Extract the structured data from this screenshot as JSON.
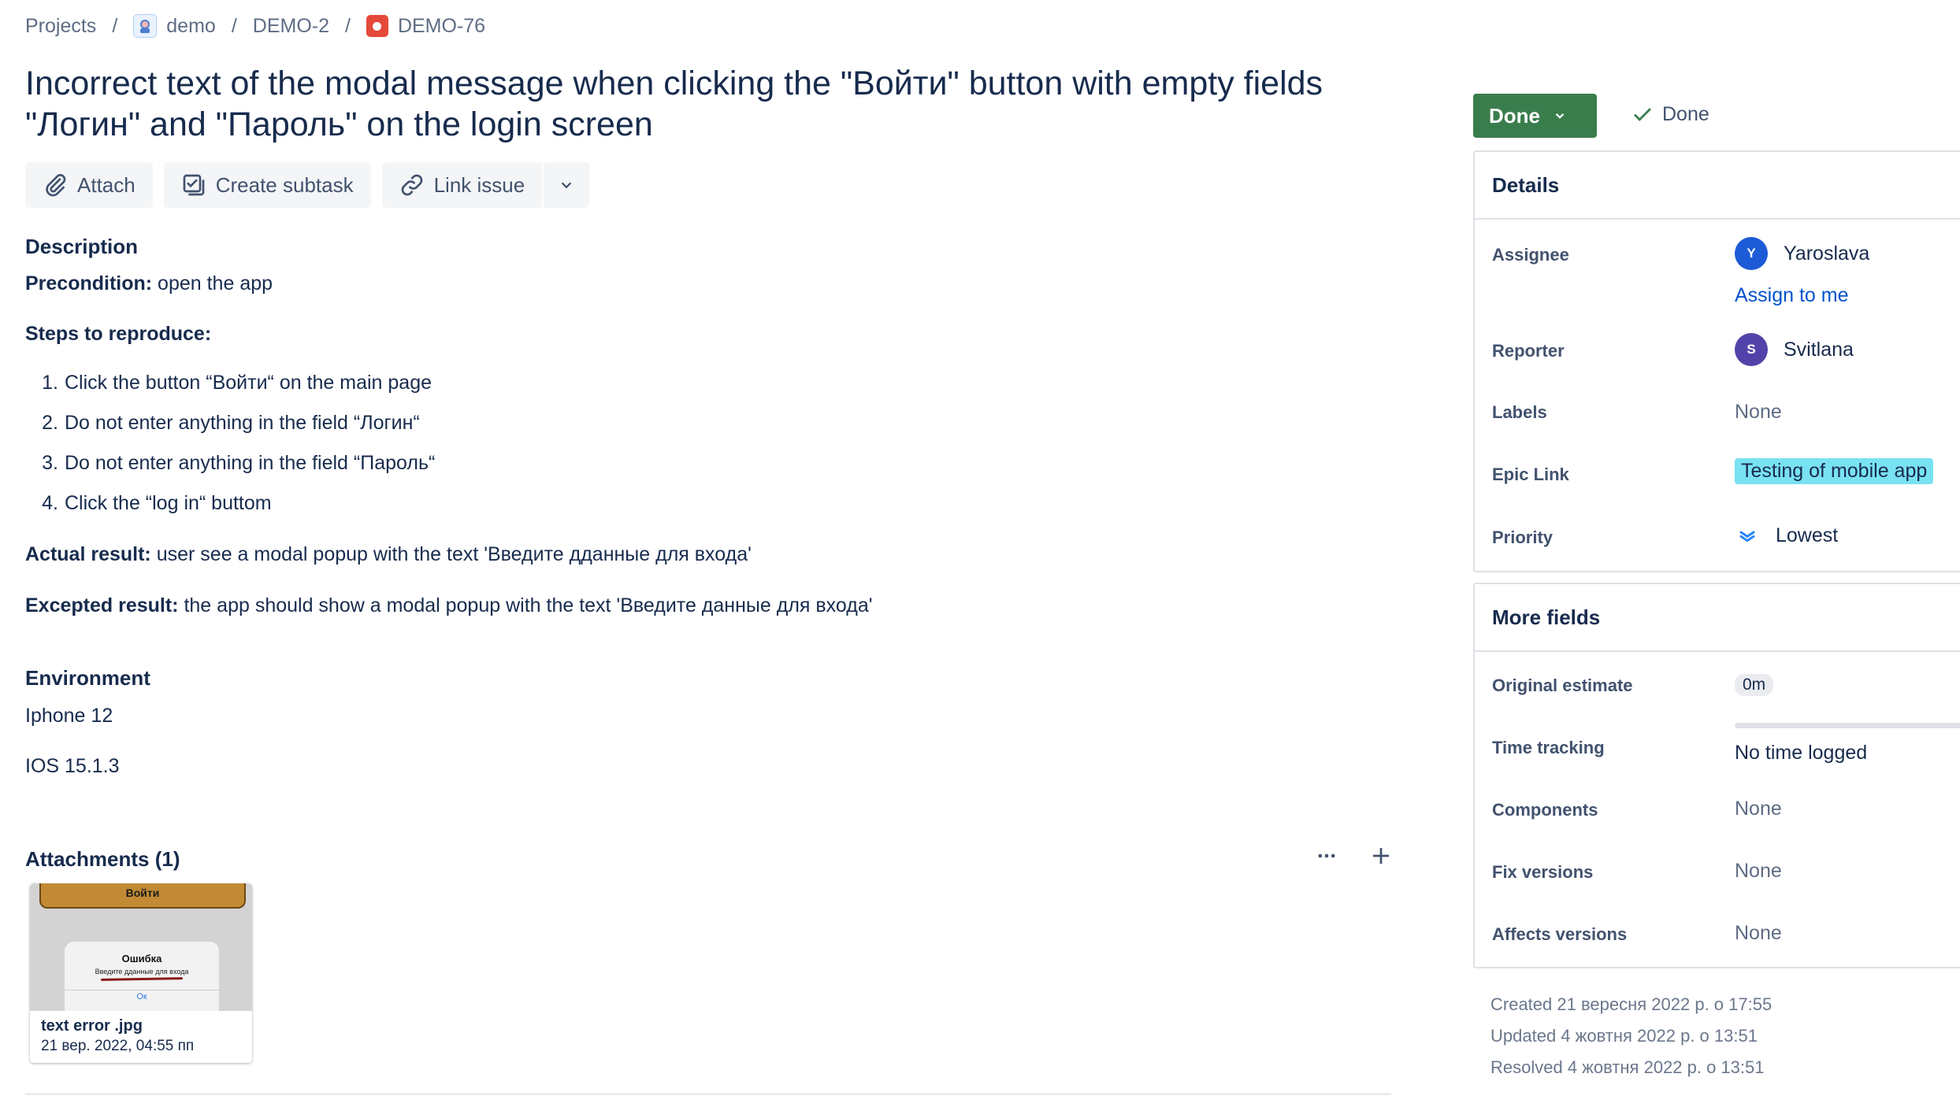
{
  "breadcrumb": {
    "projects": "Projects",
    "project": "demo",
    "parent": "DEMO-2",
    "issue": "DEMO-76"
  },
  "title": "Incorrect text of the modal message when clicking the \"Войти\" button with empty fields \"Логин\" and \"Пароль\" on the login screen",
  "toolbar": {
    "attach": "Attach",
    "create_subtask": "Create subtask",
    "link_issue": "Link issue"
  },
  "description": {
    "heading": "Description",
    "precondition_label": "Precondition:",
    "precondition_text": " open the app",
    "steps_heading": "Steps to reproduce:",
    "steps": [
      {
        "num": "1.",
        "text": "Click the button “Войти“ on the main page"
      },
      {
        "num": "2.",
        "text": "Do not enter anything in the field “Логин“"
      },
      {
        "num": "3.",
        "text": "Do not enter anything in the field “Пароль“"
      },
      {
        "num": "4.",
        "text": "Click the “log in“ buttom"
      }
    ],
    "actual_label": "Actual result:",
    "actual_text": " user see a modal popup with the text 'Введите дданные для входа'",
    "expected_label": "Excepted result:",
    "expected_text": " the app should show a modal popup with the text 'Введите данные для входа'"
  },
  "environment": {
    "heading": "Environment",
    "lines": [
      "Iphone 12",
      "IOS 15.1.3"
    ]
  },
  "attachments": {
    "heading": "Attachments (1)",
    "file_name": "text error .jpg",
    "file_date": "21 вер. 2022, 04:55 пп",
    "thumb": {
      "button_text": "Войти",
      "modal_title": "Ошибка",
      "modal_text": "Введите дданные для входа",
      "modal_ok": "Ок"
    }
  },
  "status": {
    "button_label": "Done",
    "resolution": "Done",
    "button_color": "#3a7d4d"
  },
  "details": {
    "heading": "Details",
    "assignee_label": "Assignee",
    "assignee_initial": "Y",
    "assignee_name": "Yaroslava",
    "assignee_color": "#1d5bd6",
    "assign_to_me": "Assign to me",
    "reporter_label": "Reporter",
    "reporter_initial": "S",
    "reporter_name": "Svitlana",
    "reporter_color": "#5243aa",
    "labels_label": "Labels",
    "labels_value": "None",
    "epic_label": "Epic Link",
    "epic_value": "Testing of mobile app",
    "priority_label": "Priority",
    "priority_value": "Lowest"
  },
  "more_fields": {
    "heading": "More fields",
    "original_estimate_label": "Original estimate",
    "original_estimate_value": "0m",
    "time_tracking_label": "Time tracking",
    "time_tracking_value": "No time logged",
    "components_label": "Components",
    "components_value": "None",
    "fix_versions_label": "Fix versions",
    "fix_versions_value": "None",
    "affects_versions_label": "Affects versions",
    "affects_versions_value": "None"
  },
  "meta": {
    "created": "Created 21 вересня 2022 р. о 17:55",
    "updated": "Updated 4 жовтня 2022 р. о 13:51",
    "resolved": "Resolved 4 жовтня 2022 р. о 13:51"
  }
}
